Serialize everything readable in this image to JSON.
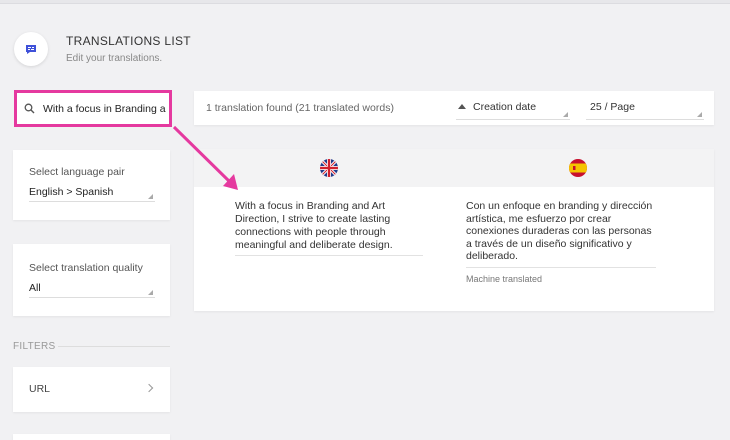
{
  "header": {
    "title": "TRANSLATIONS LIST",
    "subtitle": "Edit your translations.",
    "icon": "translation-icon",
    "accent_color": "#3f51d9"
  },
  "search": {
    "value": "With a focus in Branding a",
    "icon": "search-icon",
    "highlight_color": "#e5399f"
  },
  "results_bar": {
    "count_text": "1 translation found (21 translated words)",
    "sort_label": "Creation date",
    "per_page_label": "25 / Page"
  },
  "sidebar": {
    "language_pair": {
      "label": "Select language pair",
      "value": "English > Spanish"
    },
    "quality": {
      "label": "Select translation quality",
      "value": "All"
    },
    "filters_heading": "FILTERS",
    "url_filter_label": "URL"
  },
  "translation": {
    "source_flag": "uk-flag-icon",
    "target_flag": "spain-flag-icon",
    "source_text": "With a focus in Branding and Art Direction, I strive to create lasting connections with people through meaningful and deliberate design.",
    "target_text": "Con un enfoque en branding y dirección artística, me esfuerzo por crear conexiones duraderas con las personas a través de un diseño significativo y deliberado.",
    "status_note": "Machine translated"
  }
}
